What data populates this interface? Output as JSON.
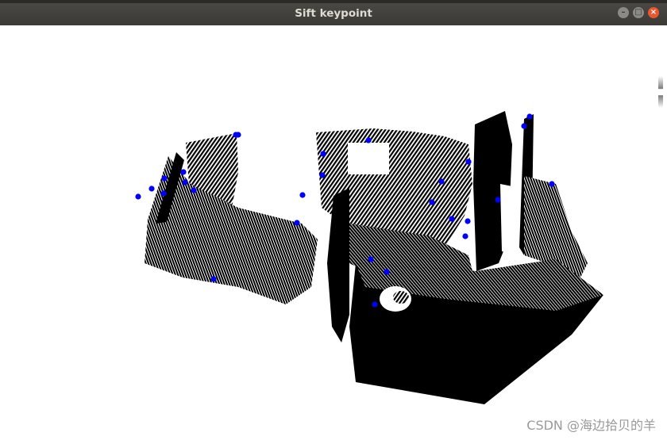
{
  "window": {
    "title": "Sift keypoint",
    "buttons": {
      "minimize_icon": "minimize-icon",
      "maximize_icon": "maximize-icon",
      "close_icon": "close-icon"
    }
  },
  "viewer": {
    "background": "#ffffff",
    "point_color": "#000000",
    "keypoint_color": "#0000ff"
  },
  "watermark": "CSDN @海边拾贝的羊"
}
